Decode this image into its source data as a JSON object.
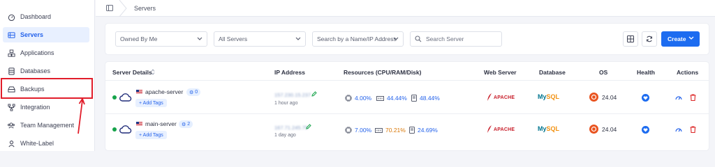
{
  "sidebar": {
    "items": [
      {
        "label": "Dashboard",
        "icon": "dashboard-icon",
        "active": false
      },
      {
        "label": "Servers",
        "icon": "servers-icon",
        "active": true
      },
      {
        "label": "Applications",
        "icon": "applications-icon",
        "active": false
      },
      {
        "label": "Databases",
        "icon": "databases-icon",
        "active": false
      },
      {
        "label": "Backups",
        "icon": "backups-icon",
        "active": false
      },
      {
        "label": "Integration",
        "icon": "integration-icon",
        "active": false
      },
      {
        "label": "Team Management",
        "icon": "team-icon",
        "active": false
      },
      {
        "label": "White-Label",
        "icon": "white-label-icon",
        "active": false
      }
    ],
    "highlight_color": "#e11d2a"
  },
  "breadcrumb": {
    "current": "Servers"
  },
  "filters": {
    "owned_by": "Owned By Me",
    "servers": "All Servers",
    "search_by": "Search by a Name/IP Address",
    "search_placeholder": "Search Server",
    "create_label": "Create"
  },
  "table": {
    "headers": {
      "server_details": "Server Details",
      "ip": "IP Address",
      "resources": "Resources (CPU/RAM/Disk)",
      "web_server": "Web Server",
      "database": "Database",
      "os": "OS",
      "health": "Health",
      "actions": "Actions"
    },
    "rows": [
      {
        "name": "apache-server",
        "tag_count": "0",
        "add_tags": "+ Add Tags",
        "ip": "157.230.15.237",
        "updated": "1 hour ago",
        "cpu": "4.00%",
        "ram": "44.44%",
        "disk": "48.44%",
        "web_server": "APACHE",
        "database_my": "My",
        "database_sql": "SQL",
        "os_version": "24.04"
      },
      {
        "name": "main-server",
        "tag_count": "2",
        "add_tags": "+ Add Tags",
        "ip": "167.71.245.75",
        "updated": "1 day ago",
        "cpu": "7.00%",
        "ram": "70.21%",
        "disk": "24.69%",
        "web_server": "APACHE",
        "database_my": "My",
        "database_sql": "SQL",
        "os_version": "24.04"
      }
    ]
  },
  "colors": {
    "accent": "#1d6cf0",
    "status_online": "#16a34a",
    "ram_warning": "#d97706"
  }
}
